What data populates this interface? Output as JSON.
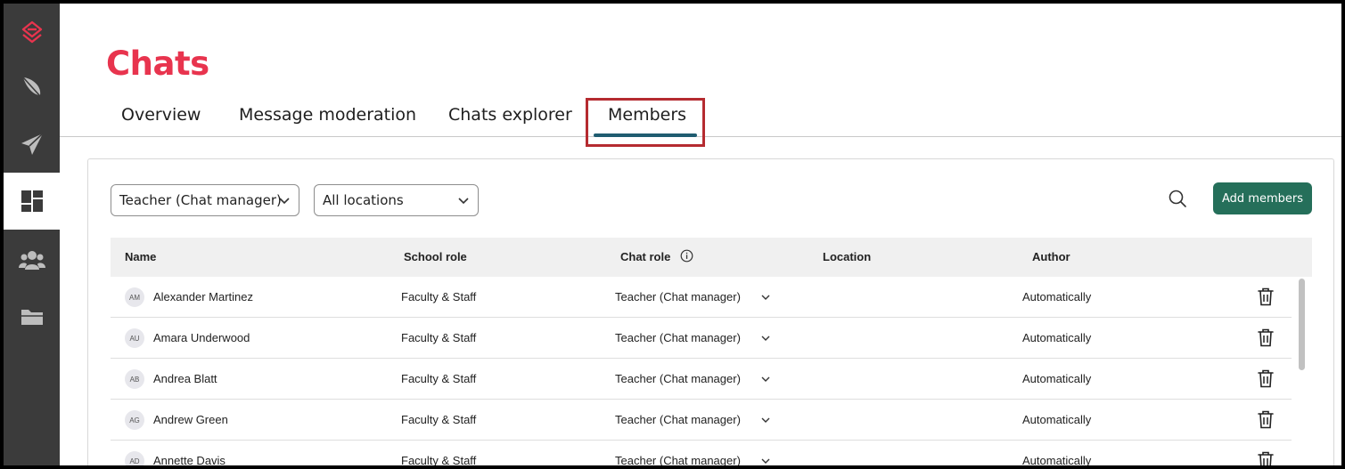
{
  "page": {
    "title": "Chats"
  },
  "sidebar": {
    "items": [
      {
        "icon": "logo-icon"
      },
      {
        "icon": "feather-icon"
      },
      {
        "icon": "paper-plane-icon"
      },
      {
        "icon": "dashboard-icon",
        "active": true
      },
      {
        "icon": "users-icon"
      },
      {
        "icon": "folder-icon"
      }
    ]
  },
  "tabs": [
    {
      "label": "Overview"
    },
    {
      "label": "Message moderation"
    },
    {
      "label": "Chats explorer"
    },
    {
      "label": "Members",
      "active": true
    }
  ],
  "filters": {
    "role_filter": "Teacher (Chat manager)",
    "location_filter": "All locations"
  },
  "actions": {
    "add_members_label": "Add members"
  },
  "table": {
    "columns": [
      "Name",
      "School role",
      "Chat role",
      "Location",
      "Author"
    ],
    "rows": [
      {
        "initials": "AM",
        "name": "Alexander Martinez",
        "school_role": "Faculty & Staff",
        "chat_role": "Teacher (Chat manager)",
        "location": "",
        "author": "Automatically"
      },
      {
        "initials": "AU",
        "name": "Amara Underwood",
        "school_role": "Faculty & Staff",
        "chat_role": "Teacher (Chat manager)",
        "location": "",
        "author": "Automatically"
      },
      {
        "initials": "AB",
        "name": "Andrea Blatt",
        "school_role": "Faculty & Staff",
        "chat_role": "Teacher (Chat manager)",
        "location": "",
        "author": "Automatically"
      },
      {
        "initials": "AG",
        "name": "Andrew Green",
        "school_role": "Faculty & Staff",
        "chat_role": "Teacher (Chat manager)",
        "location": "",
        "author": "Automatically"
      },
      {
        "initials": "AD",
        "name": "Annette Davis",
        "school_role": "Faculty & Staff",
        "chat_role": "Teacher (Chat manager)",
        "location": "",
        "author": "Automatically"
      }
    ]
  },
  "colors": {
    "brand": "#e8344e",
    "accent": "#256f5a",
    "tab_underline": "#1f5c70",
    "highlight_box": "#b52b30",
    "sidebar": "#3b3b3b"
  }
}
